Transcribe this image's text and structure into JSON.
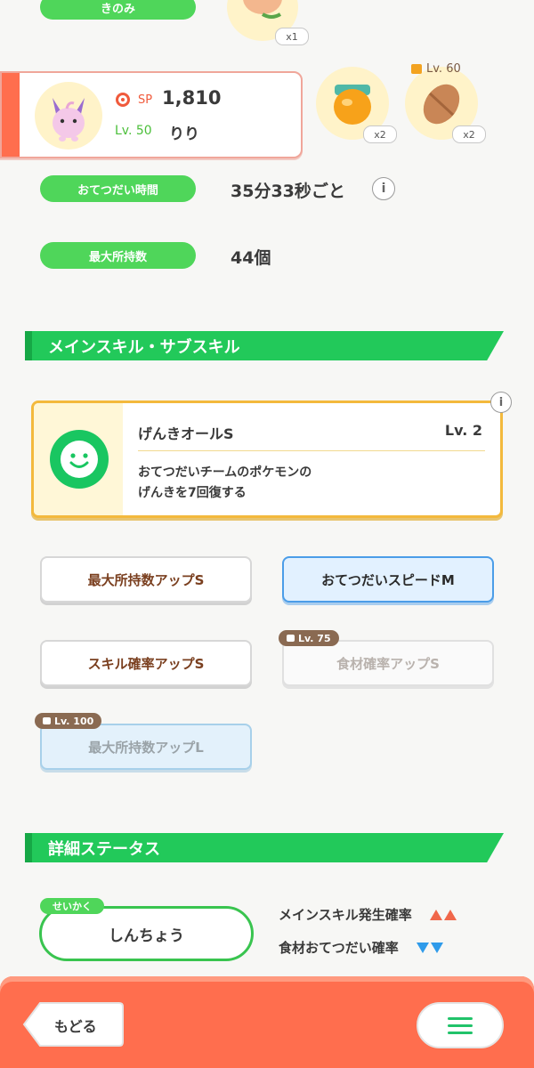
{
  "top": {
    "berry_label": "きのみ",
    "berry_count": "x1"
  },
  "pokemon_card": {
    "sp_label": "SP",
    "sp_value": "1,810",
    "level": "Lv. 50",
    "nickname": "りり"
  },
  "ingredients": [
    {
      "count": "x2"
    },
    {
      "count": "x2",
      "unlock_level": "Lv. 60"
    }
  ],
  "help_time": {
    "label": "おてつだい時間",
    "value": "35分33秒ごと"
  },
  "max_carry": {
    "label": "最大所持数",
    "value": "44個"
  },
  "skills_section": {
    "title": "メインスキル・サブスキル",
    "main_skill": {
      "name": "げんきオールS",
      "level": "Lv. 2",
      "description_line1": "おてつだいチームのポケモンの",
      "description_line2": "げんきを7回復する"
    },
    "sub_skills": [
      {
        "label": "最大所持数アップS"
      },
      {
        "label": "おてつだいスピードM"
      },
      {
        "label": "スキル確率アップS"
      },
      {
        "label": "食材確率アップS",
        "lock": "Lv. 75"
      },
      {
        "label": "最大所持数アップL",
        "lock": "Lv. 100"
      }
    ]
  },
  "details_section": {
    "title": "詳細ステータス",
    "nature_tag": "せいかく",
    "nature_value": "しんちょう",
    "stat_up": "メインスキル発生確率",
    "stat_down": "食材おてつだい確率"
  },
  "footer": {
    "back_label": "もどる"
  },
  "colors": {
    "accent_green": "#22c95a",
    "footer_orange": "#ff6e4e",
    "up_color": "#f0674a",
    "down_color": "#2f9bea"
  }
}
